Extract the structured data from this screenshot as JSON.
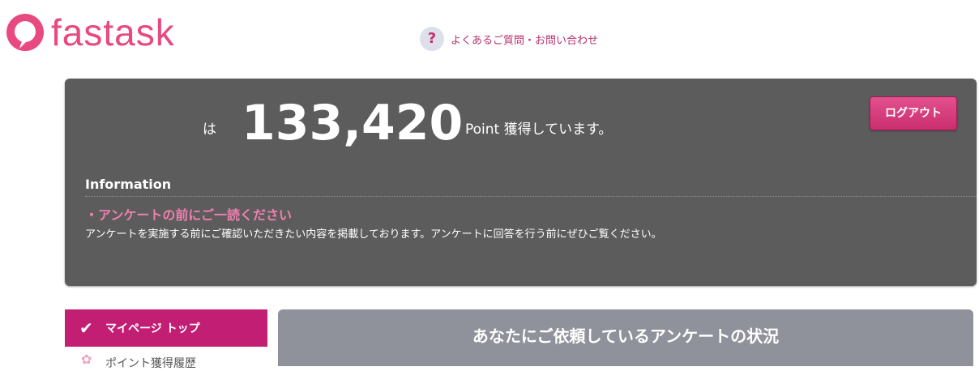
{
  "brand": {
    "name": "fastask",
    "color": "#e8497e"
  },
  "header": {
    "help_icon": "?",
    "help_link": "よくあるご質問・お問い合わせ"
  },
  "account": {
    "prefix": "は",
    "points": "133,420",
    "points_suffix": "Point 獲得しています。",
    "logout_label": "ログアウト"
  },
  "information": {
    "title": "Information",
    "notice_title": "・アンケートの前にご一読ください",
    "notice_text": "アンケートを実施する前にご確認いただきたい内容を掲載しております。アンケートに回答を行う前にぜひご覧ください。"
  },
  "sidebar": {
    "items": [
      {
        "label": "マイページ トップ",
        "active": true,
        "icon": "check-icon"
      },
      {
        "label": "ポイント獲得履歴",
        "active": false,
        "icon": "flower-icon"
      }
    ]
  },
  "main": {
    "section_title": "あなたにご依頼しているアンケートの状況"
  },
  "colors": {
    "accent": "#c21f74",
    "panel": "#5c5c5c",
    "notice": "#f07fb0"
  }
}
